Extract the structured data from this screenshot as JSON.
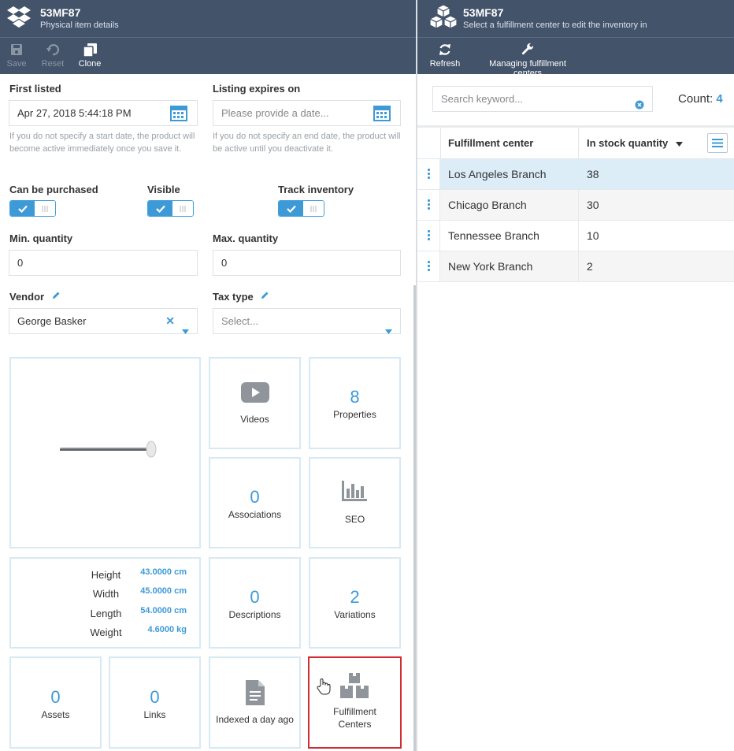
{
  "left": {
    "title": "53MF87",
    "subtitle": "Physical item details",
    "toolbar": {
      "save": "Save",
      "reset": "Reset",
      "clone": "Clone"
    },
    "first_listed": {
      "label": "First listed",
      "value": "Apr 27, 2018 5:44:18 PM",
      "help": "If you do not specify a start date, the product will become active immediately once you save it."
    },
    "expires": {
      "label": "Listing expires on",
      "placeholder": "Please provide a date...",
      "help": "If you do not specify an end date, the product will be active until you deactivate it."
    },
    "can_purchase": {
      "label": "Can be purchased",
      "on": true
    },
    "visible": {
      "label": "Visible",
      "on": true
    },
    "track_inventory": {
      "label": "Track inventory",
      "on": true
    },
    "min_qty": {
      "label": "Min. quantity",
      "value": "0"
    },
    "max_qty": {
      "label": "Max. quantity",
      "value": "0"
    },
    "vendor": {
      "label": "Vendor",
      "value": "George Basker"
    },
    "tax_type": {
      "label": "Tax type",
      "placeholder": "Select..."
    },
    "tiles": {
      "videos": {
        "label": "Videos"
      },
      "properties": {
        "count": "8",
        "label": "Properties"
      },
      "associations": {
        "count": "0",
        "label": "Associations"
      },
      "seo": {
        "label": "SEO"
      },
      "descriptions": {
        "count": "0",
        "label": "Descriptions"
      },
      "variations": {
        "count": "2",
        "label": "Variations"
      },
      "assets": {
        "count": "0",
        "label": "Assets"
      },
      "links": {
        "count": "0",
        "label": "Links"
      },
      "indexed": {
        "label": "Indexed a day ago"
      },
      "fulfillment": {
        "label1": "Fulfillment",
        "label2": "Centers"
      }
    },
    "dimensions": [
      {
        "name": "Height",
        "value": "43.0000 cm"
      },
      {
        "name": "Width",
        "value": "45.0000 cm"
      },
      {
        "name": "Length",
        "value": "54.0000 cm"
      },
      {
        "name": "Weight",
        "value": "4.6000 kg"
      }
    ]
  },
  "right": {
    "title": "53MF87",
    "subtitle": "Select a fulfillment center to edit the inventory in",
    "toolbar": {
      "refresh": "Refresh",
      "manage": "Managing fulfillment centers"
    },
    "search_placeholder": "Search keyword...",
    "count_label": "Count:",
    "count_value": "4",
    "columns": {
      "center": "Fulfillment center",
      "qty": "In stock quantity"
    },
    "rows": [
      {
        "name": "Los Angeles Branch",
        "qty": "38"
      },
      {
        "name": "Chicago Branch",
        "qty": "30"
      },
      {
        "name": "Tennessee Branch",
        "qty": "10"
      },
      {
        "name": "New York Branch",
        "qty": "2"
      }
    ],
    "colors": {
      "accent": "#3e9ad7",
      "header": "#43536a",
      "selected_row": "#dcedf8",
      "alt_row": "#f5f5f5"
    }
  }
}
